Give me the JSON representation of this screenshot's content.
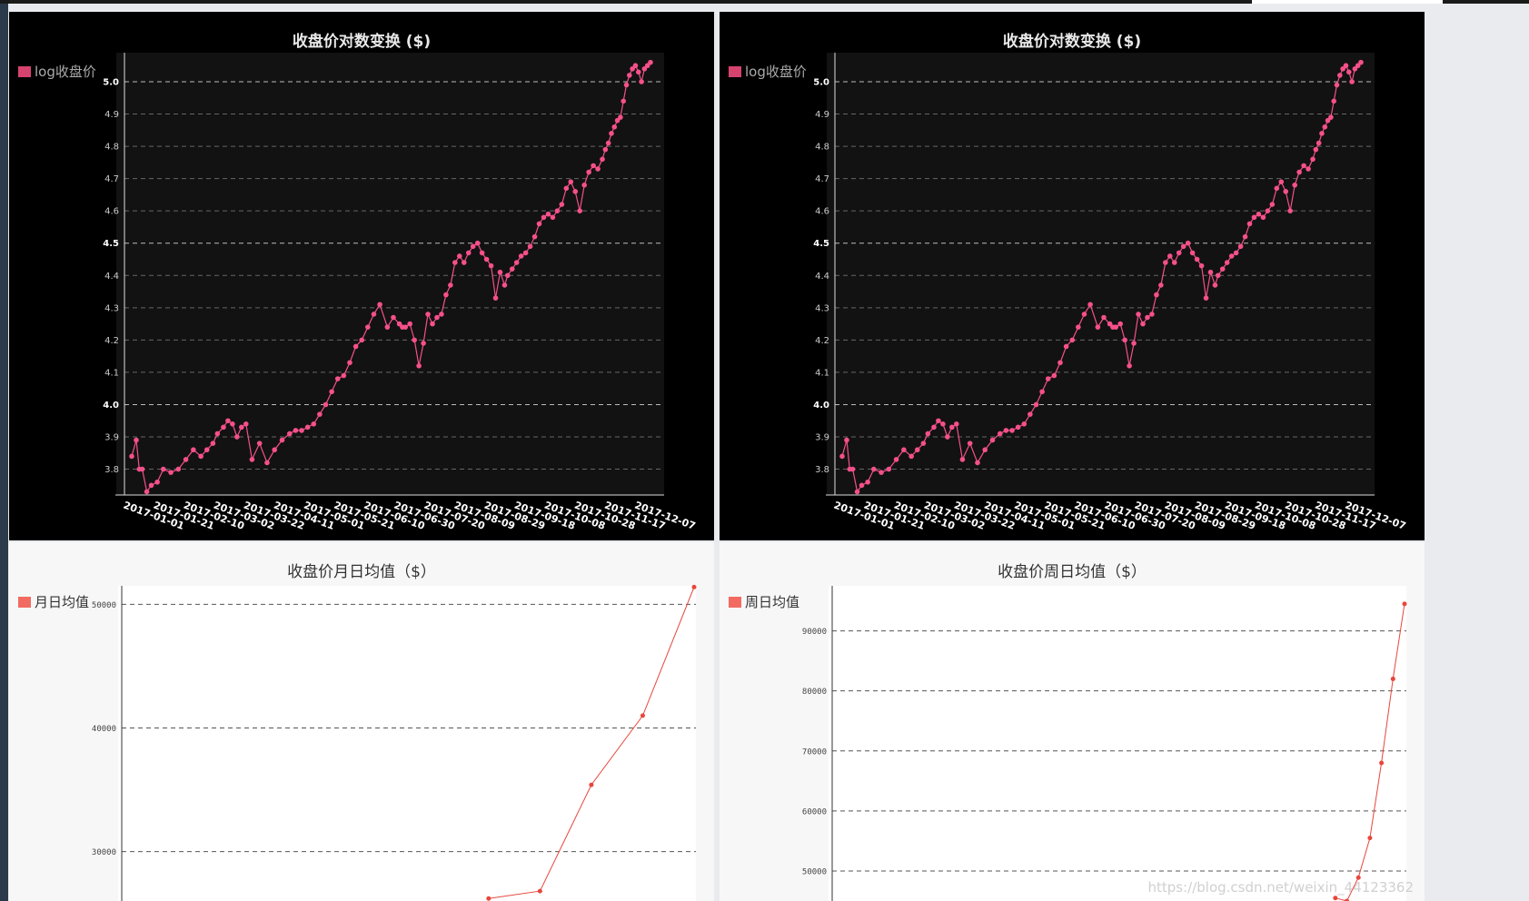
{
  "watermark": "https://blog.csdn.net/weixin_44123362",
  "chart_data": [
    {
      "type": "line",
      "title": "收盘价对数变换 ($)",
      "theme": "dark",
      "line_color": "#f5508a",
      "legend": {
        "label": "log收盘价",
        "color": "#d6436f",
        "placement": "top-left"
      },
      "grid": true,
      "ylim": [
        3.72,
        5.09
      ],
      "yticks": [
        3.8,
        3.9,
        4.0,
        4.1,
        4.2,
        4.3,
        4.4,
        4.5,
        4.6,
        4.7,
        4.8,
        4.9,
        5.0
      ],
      "ytick_labels": [
        "3.8",
        "3.9",
        "4.0",
        "4.1",
        "4.2",
        "4.3",
        "4.4",
        "4.5",
        "4.6",
        "4.7",
        "4.8",
        "4.9",
        "5.0"
      ],
      "xticks": [
        "2017-01-01",
        "2017-01-21",
        "2017-02-10",
        "2017-03-02",
        "2017-03-22",
        "2017-04-11",
        "2017-05-01",
        "2017-05-21",
        "2017-06-10",
        "2017-06-30",
        "2017-07-20",
        "2017-08-09",
        "2017-08-29",
        "2017-09-18",
        "2017-10-08",
        "2017-10-28",
        "2017-11-17",
        "2017-12-07"
      ],
      "x_start": "2017-01-01",
      "x_end": "2017-12-12",
      "series": [
        {
          "x": [
            "2017-01-01",
            "2017-01-04",
            "2017-01-06",
            "2017-01-08",
            "2017-01-11",
            "2017-01-14",
            "2017-01-18",
            "2017-01-22",
            "2017-01-27",
            "2017-02-01",
            "2017-02-06",
            "2017-02-11",
            "2017-02-16",
            "2017-02-20",
            "2017-02-24",
            "2017-02-27",
            "2017-03-03",
            "2017-03-06",
            "2017-03-09",
            "2017-03-12",
            "2017-03-15",
            "2017-03-18",
            "2017-03-22",
            "2017-03-27",
            "2017-04-01",
            "2017-04-06",
            "2017-04-11",
            "2017-04-16",
            "2017-04-20",
            "2017-04-24",
            "2017-04-28",
            "2017-05-02",
            "2017-05-06",
            "2017-05-10",
            "2017-05-14",
            "2017-05-18",
            "2017-05-22",
            "2017-05-26",
            "2017-05-30",
            "2017-06-03",
            "2017-06-07",
            "2017-06-11",
            "2017-06-15",
            "2017-06-20",
            "2017-06-24",
            "2017-06-28",
            "2017-06-30",
            "2017-07-02",
            "2017-07-05",
            "2017-07-08",
            "2017-07-11",
            "2017-07-14",
            "2017-07-17",
            "2017-07-20",
            "2017-07-23",
            "2017-07-26",
            "2017-07-29",
            "2017-08-01",
            "2017-08-04",
            "2017-08-07",
            "2017-08-10",
            "2017-08-13",
            "2017-08-16",
            "2017-08-19",
            "2017-08-22",
            "2017-08-25",
            "2017-08-28",
            "2017-08-31",
            "2017-09-03",
            "2017-09-06",
            "2017-09-08",
            "2017-09-11",
            "2017-09-14",
            "2017-09-17",
            "2017-09-20",
            "2017-09-23",
            "2017-09-26",
            "2017-09-29",
            "2017-10-02",
            "2017-10-05",
            "2017-10-08",
            "2017-10-11",
            "2017-10-14",
            "2017-10-17",
            "2017-10-20",
            "2017-10-23",
            "2017-10-26",
            "2017-10-29",
            "2017-11-01",
            "2017-11-04",
            "2017-11-07",
            "2017-11-10",
            "2017-11-12",
            "2017-11-14",
            "2017-11-16",
            "2017-11-18",
            "2017-11-20",
            "2017-11-22",
            "2017-11-24",
            "2017-11-26",
            "2017-11-28",
            "2017-11-30",
            "2017-12-02",
            "2017-12-04",
            "2017-12-06",
            "2017-12-08",
            "2017-12-10",
            "2017-12-12"
          ],
          "y": [
            3.84,
            3.89,
            3.8,
            3.8,
            3.73,
            3.75,
            3.76,
            3.8,
            3.79,
            3.8,
            3.83,
            3.86,
            3.84,
            3.86,
            3.88,
            3.91,
            3.93,
            3.95,
            3.94,
            3.9,
            3.93,
            3.94,
            3.83,
            3.88,
            3.82,
            3.86,
            3.89,
            3.91,
            3.92,
            3.92,
            3.93,
            3.94,
            3.97,
            4.0,
            4.04,
            4.08,
            4.09,
            4.13,
            4.18,
            4.2,
            4.24,
            4.28,
            4.31,
            4.24,
            4.27,
            4.25,
            4.24,
            4.24,
            4.25,
            4.2,
            4.12,
            4.19,
            4.28,
            4.25,
            4.27,
            4.28,
            4.34,
            4.37,
            4.44,
            4.46,
            4.44,
            4.47,
            4.49,
            4.5,
            4.47,
            4.45,
            4.43,
            4.33,
            4.41,
            4.37,
            4.4,
            4.42,
            4.44,
            4.46,
            4.47,
            4.49,
            4.52,
            4.56,
            4.58,
            4.59,
            4.58,
            4.6,
            4.62,
            4.67,
            4.69,
            4.66,
            4.6,
            4.68,
            4.72,
            4.74,
            4.73,
            4.76,
            4.79,
            4.81,
            4.84,
            4.86,
            4.88,
            4.89,
            4.94,
            4.99,
            5.02,
            5.04,
            5.05,
            5.03,
            5.0,
            5.04,
            5.05,
            5.06
          ]
        }
      ]
    },
    {
      "type": "line",
      "title": "收盘价对数变换 ($)",
      "theme": "dark",
      "line_color": "#f5508a",
      "legend": {
        "label": "log收盘价",
        "color": "#d6436f",
        "placement": "top-left"
      },
      "grid": true,
      "ylim": [
        3.72,
        5.09
      ],
      "yticks": [
        3.8,
        3.9,
        4.0,
        4.1,
        4.2,
        4.3,
        4.4,
        4.5,
        4.6,
        4.7,
        4.8,
        4.9,
        5.0
      ],
      "ytick_labels": [
        "3.8",
        "3.9",
        "4.0",
        "4.1",
        "4.2",
        "4.3",
        "4.4",
        "4.5",
        "4.6",
        "4.7",
        "4.8",
        "4.9",
        "5.0"
      ],
      "xticks": [
        "2017-01-01",
        "2017-01-21",
        "2017-02-10",
        "2017-03-02",
        "2017-03-22",
        "2017-04-11",
        "2017-05-01",
        "2017-05-21",
        "2017-06-10",
        "2017-06-30",
        "2017-07-20",
        "2017-08-09",
        "2017-08-29",
        "2017-09-18",
        "2017-10-08",
        "2017-10-28",
        "2017-11-17",
        "2017-12-07"
      ],
      "x_start": "2017-01-01",
      "x_end": "2017-12-12",
      "series": [
        {
          "x": [
            "2017-01-01",
            "2017-01-04",
            "2017-01-06",
            "2017-01-08",
            "2017-01-11",
            "2017-01-14",
            "2017-01-18",
            "2017-01-22",
            "2017-01-27",
            "2017-02-01",
            "2017-02-06",
            "2017-02-11",
            "2017-02-16",
            "2017-02-20",
            "2017-02-24",
            "2017-02-27",
            "2017-03-03",
            "2017-03-06",
            "2017-03-09",
            "2017-03-12",
            "2017-03-15",
            "2017-03-18",
            "2017-03-22",
            "2017-03-27",
            "2017-04-01",
            "2017-04-06",
            "2017-04-11",
            "2017-04-16",
            "2017-04-20",
            "2017-04-24",
            "2017-04-28",
            "2017-05-02",
            "2017-05-06",
            "2017-05-10",
            "2017-05-14",
            "2017-05-18",
            "2017-05-22",
            "2017-05-26",
            "2017-05-30",
            "2017-06-03",
            "2017-06-07",
            "2017-06-11",
            "2017-06-15",
            "2017-06-20",
            "2017-06-24",
            "2017-06-28",
            "2017-06-30",
            "2017-07-02",
            "2017-07-05",
            "2017-07-08",
            "2017-07-11",
            "2017-07-14",
            "2017-07-17",
            "2017-07-20",
            "2017-07-23",
            "2017-07-26",
            "2017-07-29",
            "2017-08-01",
            "2017-08-04",
            "2017-08-07",
            "2017-08-10",
            "2017-08-13",
            "2017-08-16",
            "2017-08-19",
            "2017-08-22",
            "2017-08-25",
            "2017-08-28",
            "2017-08-31",
            "2017-09-03",
            "2017-09-06",
            "2017-09-08",
            "2017-09-11",
            "2017-09-14",
            "2017-09-17",
            "2017-09-20",
            "2017-09-23",
            "2017-09-26",
            "2017-09-29",
            "2017-10-02",
            "2017-10-05",
            "2017-10-08",
            "2017-10-11",
            "2017-10-14",
            "2017-10-17",
            "2017-10-20",
            "2017-10-23",
            "2017-10-26",
            "2017-10-29",
            "2017-11-01",
            "2017-11-04",
            "2017-11-07",
            "2017-11-10",
            "2017-11-12",
            "2017-11-14",
            "2017-11-16",
            "2017-11-18",
            "2017-11-20",
            "2017-11-22",
            "2017-11-24",
            "2017-11-26",
            "2017-11-28",
            "2017-11-30",
            "2017-12-02",
            "2017-12-04",
            "2017-12-06",
            "2017-12-08",
            "2017-12-10",
            "2017-12-12"
          ],
          "y": [
            3.84,
            3.89,
            3.8,
            3.8,
            3.73,
            3.75,
            3.76,
            3.8,
            3.79,
            3.8,
            3.83,
            3.86,
            3.84,
            3.86,
            3.88,
            3.91,
            3.93,
            3.95,
            3.94,
            3.9,
            3.93,
            3.94,
            3.83,
            3.88,
            3.82,
            3.86,
            3.89,
            3.91,
            3.92,
            3.92,
            3.93,
            3.94,
            3.97,
            4.0,
            4.04,
            4.08,
            4.09,
            4.13,
            4.18,
            4.2,
            4.24,
            4.28,
            4.31,
            4.24,
            4.27,
            4.25,
            4.24,
            4.24,
            4.25,
            4.2,
            4.12,
            4.19,
            4.28,
            4.25,
            4.27,
            4.28,
            4.34,
            4.37,
            4.44,
            4.46,
            4.44,
            4.47,
            4.49,
            4.5,
            4.47,
            4.45,
            4.43,
            4.33,
            4.41,
            4.37,
            4.4,
            4.42,
            4.44,
            4.46,
            4.47,
            4.49,
            4.52,
            4.56,
            4.58,
            4.59,
            4.58,
            4.6,
            4.62,
            4.67,
            4.69,
            4.66,
            4.6,
            4.68,
            4.72,
            4.74,
            4.73,
            4.76,
            4.79,
            4.81,
            4.84,
            4.86,
            4.88,
            4.89,
            4.94,
            4.99,
            5.02,
            5.04,
            5.05,
            5.03,
            5.0,
            5.04,
            5.05,
            5.06
          ]
        }
      ]
    },
    {
      "type": "line",
      "title": "收盘价月日均值（$）",
      "theme": "light",
      "line_color": "#e8463c",
      "legend": {
        "label": "月日均值",
        "color": "#f26b60",
        "placement": "top-left"
      },
      "grid": true,
      "ylim": [
        26000,
        51500
      ],
      "yticks": [
        30000,
        40000,
        50000
      ],
      "ytick_labels": [
        "30000",
        "40000",
        "50000"
      ],
      "x_range": [
        1,
        12
      ],
      "series": [
        {
          "x": [
            8,
            9,
            10,
            11,
            12
          ],
          "y": [
            26200,
            26800,
            35400,
            41000,
            51400
          ]
        }
      ]
    },
    {
      "type": "line",
      "title": "收盘价周日均值（$）",
      "theme": "light",
      "line_color": "#e8463c",
      "legend": {
        "label": "周日均值",
        "color": "#f26b60",
        "placement": "top-left"
      },
      "grid": true,
      "ylim": [
        45000,
        97500
      ],
      "yticks": [
        50000,
        60000,
        70000,
        80000,
        90000
      ],
      "ytick_labels": [
        "50000",
        "60000",
        "70000",
        "80000",
        "90000"
      ],
      "x_range": [
        1,
        50
      ],
      "series": [
        {
          "x": [
            44,
            45,
            46,
            47,
            48,
            49,
            50
          ],
          "y": [
            45500,
            45000,
            48900,
            55500,
            68000,
            82000,
            94500
          ]
        }
      ]
    }
  ]
}
